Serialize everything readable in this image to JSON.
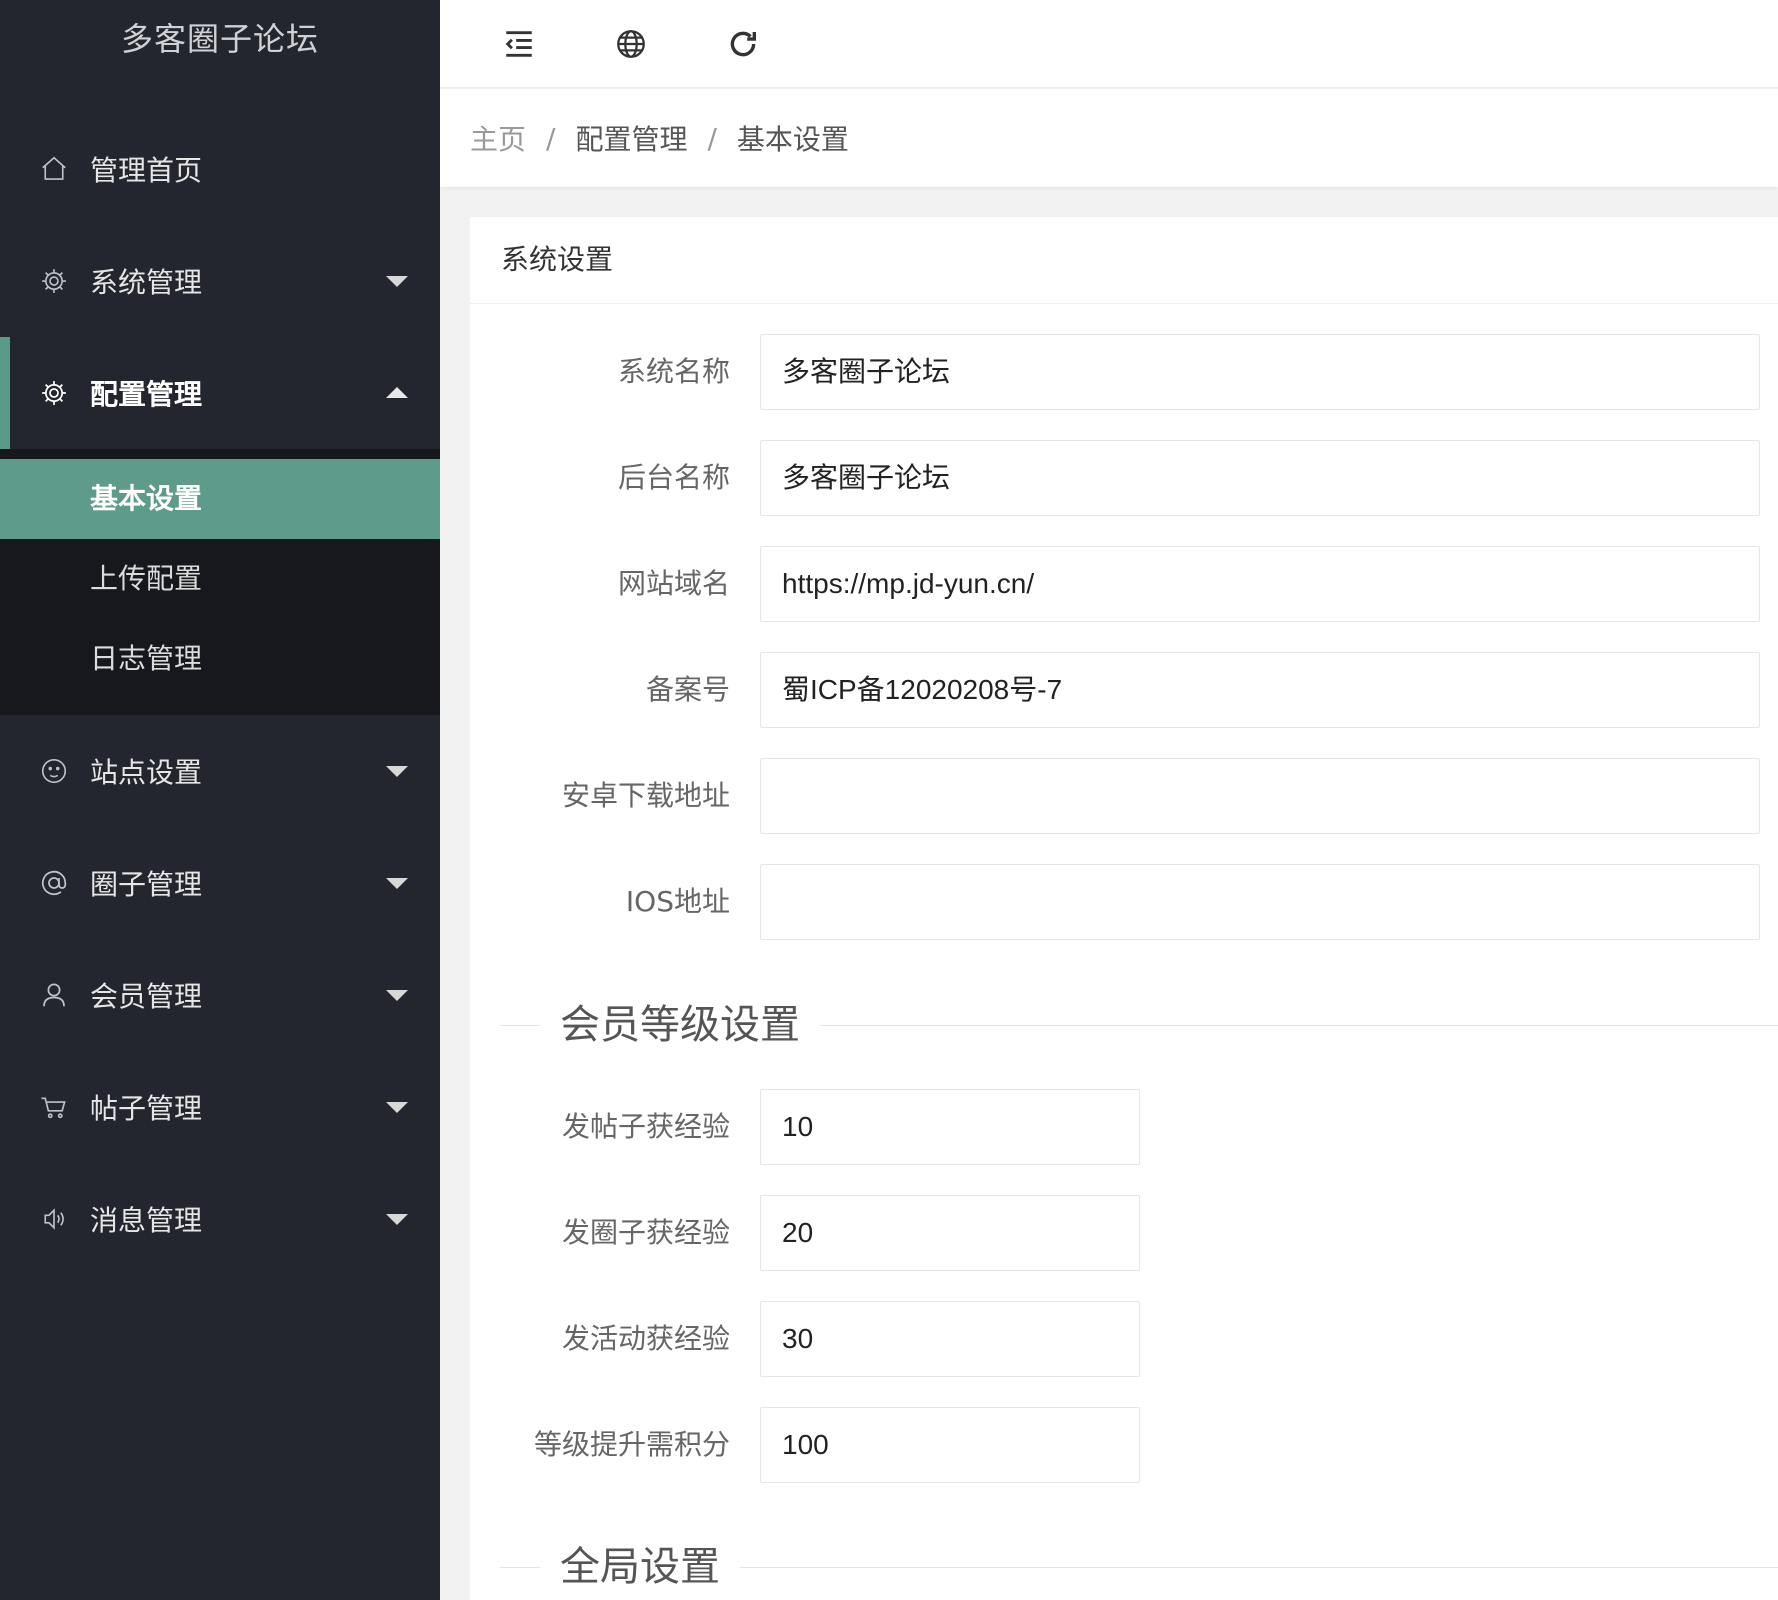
{
  "app": {
    "title": "多客圈子论坛"
  },
  "colors": {
    "sidebar_bg": "#23262e",
    "accent": "#5f9b8a",
    "submenu_bg": "#16181d"
  },
  "topbar": {
    "icons": [
      "indent-toggle-icon",
      "globe-icon",
      "refresh-icon"
    ]
  },
  "sidebar": {
    "items": [
      {
        "label": "管理首页",
        "icon": "home-icon"
      },
      {
        "label": "系统管理",
        "icon": "gear-icon"
      },
      {
        "label": "配置管理",
        "icon": "gear-icon"
      },
      {
        "label": "站点设置",
        "icon": "face-icon"
      },
      {
        "label": "圈子管理",
        "icon": "at-icon"
      },
      {
        "label": "会员管理",
        "icon": "user-icon"
      },
      {
        "label": "帖子管理",
        "icon": "cart-icon"
      },
      {
        "label": "消息管理",
        "icon": "speaker-icon"
      }
    ],
    "submenu": [
      {
        "label": "基本设置"
      },
      {
        "label": "上传配置"
      },
      {
        "label": "日志管理"
      }
    ]
  },
  "breadcrumb": {
    "home": "主页",
    "separator": "/",
    "section": "配置管理",
    "current": "基本设置"
  },
  "card": {
    "title": "系统设置",
    "fields": [
      {
        "label": "系统名称",
        "value": "多客圈子论坛"
      },
      {
        "label": "后台名称",
        "value": "多客圈子论坛"
      },
      {
        "label": "网站域名",
        "value": "https://mp.jd-yun.cn/"
      },
      {
        "label": "备案号",
        "value": "蜀ICP备12020208号-7"
      },
      {
        "label": "安卓下载地址",
        "value": ""
      },
      {
        "label": "IOS地址",
        "value": ""
      }
    ],
    "level_section": {
      "title": "会员等级设置",
      "fields": [
        {
          "label": "发帖子获经验",
          "value": "10"
        },
        {
          "label": "发圈子获经验",
          "value": "20"
        },
        {
          "label": "发活动获经验",
          "value": "30"
        },
        {
          "label": "等级提升需积分",
          "value": "100"
        }
      ]
    },
    "global_section": {
      "title": "全局设置"
    }
  }
}
